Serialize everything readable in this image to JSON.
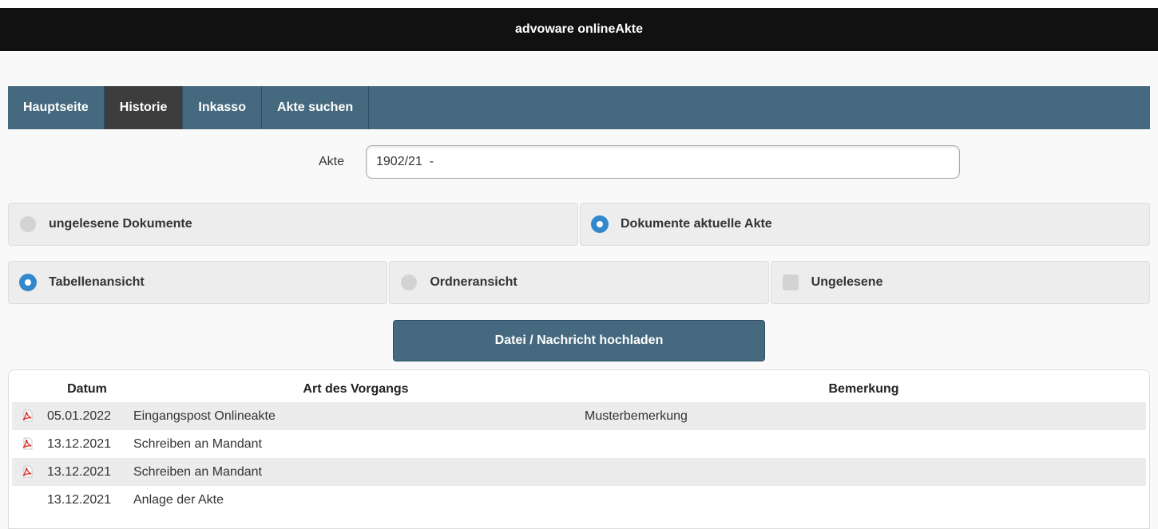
{
  "header": {
    "title": "advoware onlineAkte"
  },
  "nav": {
    "tabs": [
      {
        "label": "Hauptseite",
        "active": false
      },
      {
        "label": "Historie",
        "active": true
      },
      {
        "label": "Inkasso",
        "active": false
      },
      {
        "label": "Akte suchen",
        "active": false
      }
    ]
  },
  "akte": {
    "label": "Akte",
    "value": "1902/21  -"
  },
  "filter": {
    "unread_label": "ungelesene Dokumente",
    "unread_selected": false,
    "current_label": "Dokumente aktuelle Akte",
    "current_selected": true
  },
  "view": {
    "table_label": "Tabellenansicht",
    "table_selected": true,
    "folder_label": "Ordneransicht",
    "folder_selected": false,
    "unread_only_label": "Ungelesene",
    "unread_only_checked": false
  },
  "upload": {
    "label": "Datei / Nachricht hochladen"
  },
  "table": {
    "columns": [
      "Datum",
      "Art des Vorgangs",
      "Bemerkung"
    ],
    "rows": [
      {
        "icon": "pdf-icon",
        "date": "05.01.2022",
        "art": "Eingangspost Onlineakte",
        "bemerkung": "Musterbemerkung"
      },
      {
        "icon": "pdf-icon",
        "date": "13.12.2021",
        "art": "Schreiben an Mandant",
        "bemerkung": ""
      },
      {
        "icon": "pdf-icon",
        "date": "13.12.2021",
        "art": "Schreiben an Mandant",
        "bemerkung": ""
      },
      {
        "icon": "",
        "date": "13.12.2021",
        "art": "Anlage der Akte",
        "bemerkung": ""
      }
    ]
  },
  "colors": {
    "nav_bg": "#45697e",
    "header_bg": "#111111",
    "radio_on": "#3388cc",
    "pdf_red": "#d9342b"
  }
}
